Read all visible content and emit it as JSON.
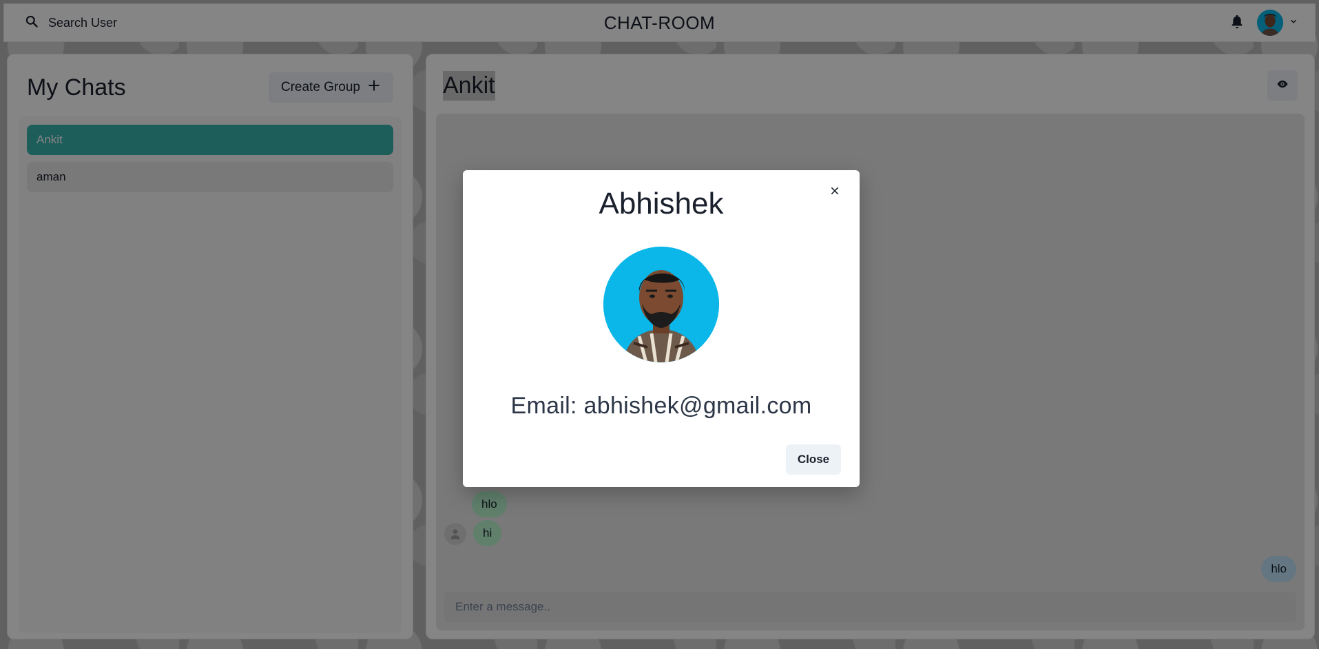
{
  "header": {
    "search_label": "Search User",
    "app_title": "CHAT-ROOM"
  },
  "sidebar": {
    "title": "My Chats",
    "create_group_label": "Create Group",
    "chats": [
      {
        "name": "Ankit",
        "active": true
      },
      {
        "name": "aman",
        "active": false
      }
    ]
  },
  "chat": {
    "name": "Ankit",
    "messages": [
      {
        "text": "hlo",
        "direction": "received"
      },
      {
        "text": "hi",
        "direction": "received"
      },
      {
        "text": "hlo",
        "direction": "sent"
      }
    ],
    "input_placeholder": "Enter a message.."
  },
  "modal": {
    "title": "Abhishek",
    "email_text": "Email: abhishek@gmail.com",
    "close_label": "Close"
  },
  "colors": {
    "active_chat": "#38b2ac",
    "received_bubble": "#b9f5d0",
    "sent_bubble": "#bee3f8",
    "avatar_bg": "#0bb6e8"
  }
}
